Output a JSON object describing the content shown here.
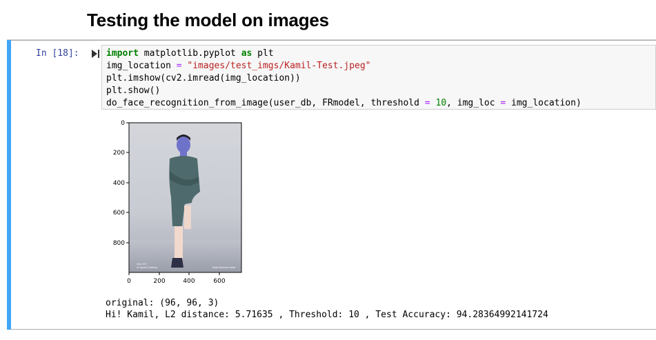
{
  "heading": "Testing the model on images",
  "cell": {
    "prompt": "In [18]:",
    "code": {
      "line1": {
        "kw1": "import",
        "mod": " matplotlib.pyplot ",
        "kw2": "as",
        "rest": " plt"
      },
      "line2": {
        "lhs": "img_location ",
        "op": "=",
        "sp": " ",
        "str": "\"images/test_imgs/Kamil-Test.jpeg\""
      },
      "line3": "plt.imshow(cv2.imread(img_location))",
      "line4": "plt.show()",
      "line5": {
        "a": "do_face_recognition_from_image(user_db, FRmodel, threshold ",
        "op1": "=",
        "b": " ",
        "num": "10",
        "c": ", img_loc ",
        "op2": "=",
        "d": " img_location)"
      }
    },
    "plot": {
      "y_ticks": [
        "0",
        "200",
        "400",
        "600",
        "800"
      ],
      "x_ticks": [
        "0",
        "200",
        "400",
        "600"
      ],
      "photo_caption_left": "vivo V17",
      "photo_caption_left2": "AI Quad Camera",
      "photo_caption_right": "Dual-Screen mode"
    },
    "output": {
      "line1": "original: (96, 96, 3)",
      "line2": "Hi! Kamil, L2 distance: 5.71635 , Threshold: 10 , Test Accuracy: 94.28364992141724"
    }
  },
  "colors": {
    "cell_bar": "#42a5f5",
    "prompt": "#303f9f",
    "keyword": "#008000",
    "string": "#ba2121",
    "operator": "#aa22ff"
  }
}
